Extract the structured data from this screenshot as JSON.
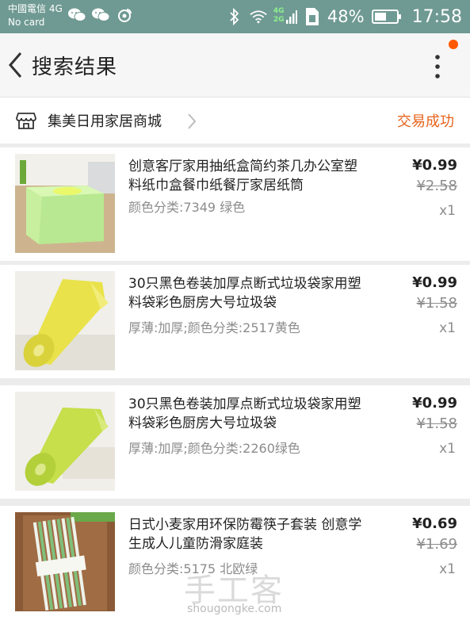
{
  "status_bar": {
    "carrier": "中國電信 4G",
    "sim": "No card",
    "battery": "48%",
    "time": "17:58",
    "network_top": "4G",
    "network_bottom": "2G"
  },
  "header": {
    "title": "搜索结果"
  },
  "shop": {
    "name": "集美日用家居商城",
    "status": "交易成功"
  },
  "items": [
    {
      "title": "创意客厅家用抽纸盒简约茶几办公室塑料纸巾盒餐巾纸餐厅家居纸筒",
      "variant": "颜色分类:7349 绿色",
      "price": "¥0.99",
      "original_price": "¥2.58",
      "qty": "x1"
    },
    {
      "title": "30只黑色卷装加厚点断式垃圾袋家用塑料袋彩色厨房大号垃圾袋",
      "variant": "厚薄:加厚;颜色分类:2517黄色",
      "price": "¥0.99",
      "original_price": "¥1.58",
      "qty": "x1"
    },
    {
      "title": "30只黑色卷装加厚点断式垃圾袋家用塑料袋彩色厨房大号垃圾袋",
      "variant": "厚薄:加厚;颜色分类:2260绿色",
      "price": "¥0.99",
      "original_price": "¥1.58",
      "qty": "x1"
    },
    {
      "title": "日式小麦家用环保防霉筷子套装 创意学生成人儿童防滑家庭装",
      "variant": "颜色分类:5175 北欧绿",
      "price": "¥0.69",
      "original_price": "¥1.69",
      "qty": "x1"
    }
  ],
  "watermark": {
    "cn": "手工客",
    "en": "shougongke.com"
  },
  "colors": {
    "status_bar": "#6f9a93",
    "accent_orange": "#e8631c",
    "notification_dot": "#ff5a00"
  }
}
